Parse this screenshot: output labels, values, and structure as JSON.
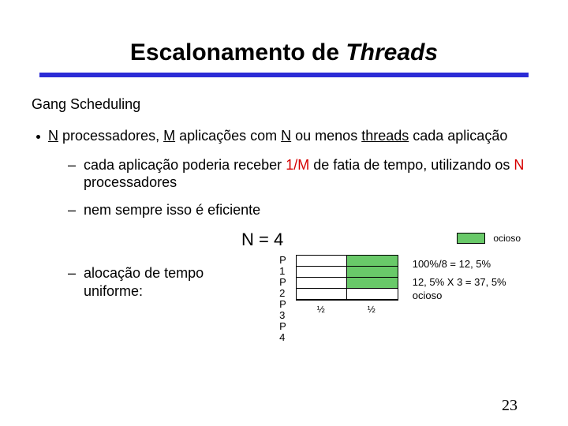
{
  "title_main": "Escalonamento de ",
  "title_em": "Threads",
  "section": "Gang Scheduling",
  "bullet1_a": "N",
  "bullet1_b": " processadores, ",
  "bullet1_c": "M",
  "bullet1_d": " aplicações com ",
  "bullet1_e": "N",
  "bullet1_f": " ou menos ",
  "bullet1_g": "threads",
  "bullet1_h": " cada aplicação",
  "sub1_a": "cada aplicação poderia receber ",
  "sub1_b": "1/M",
  "sub1_c": " de fatia de tempo, utilizando os ",
  "sub1_d": "N",
  "sub1_e": " processadores",
  "sub2": "nem sempre isso é eficiente",
  "n_eq": "N = 4",
  "legend_label": "ocioso",
  "alloc_label": "alocação de tempo uniforme:",
  "proc": {
    "p1": "P 1",
    "p2": "P 2",
    "p3": "P 3",
    "p4": "P 4"
  },
  "half": "½",
  "calc1": "100%/8 = 12, 5%",
  "calc2": "12, 5% X 3 = 37, 5% ocioso",
  "page": "23",
  "chart_data": {
    "type": "table",
    "title": "N = 4 — alocação de tempo uniforme",
    "rows": [
      "P 1",
      "P 2",
      "P 3",
      "P 4"
    ],
    "columns": [
      "½",
      "½"
    ],
    "cell_idle": [
      [
        false,
        true
      ],
      [
        false,
        true
      ],
      [
        false,
        true
      ],
      [
        false,
        false
      ]
    ],
    "legend": {
      "ocioso": true
    },
    "annotations": [
      "100%/8 = 12,5%",
      "12,5% X 3 = 37,5% ocioso"
    ]
  }
}
